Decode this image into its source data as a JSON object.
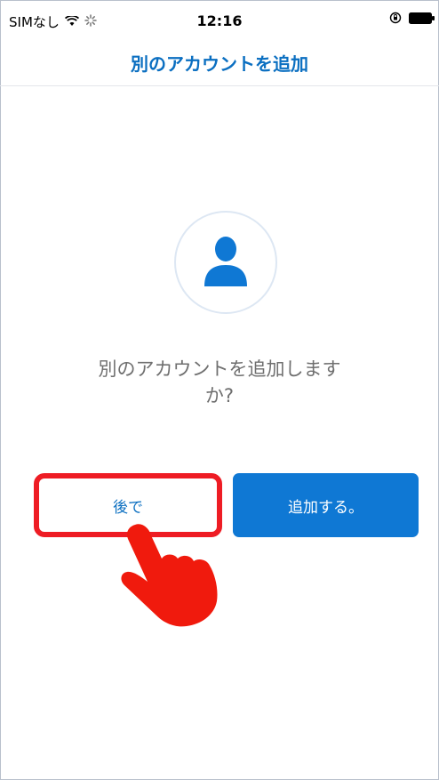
{
  "status_bar": {
    "carrier": "SIMなし",
    "time": "12:16"
  },
  "nav": {
    "title": "別のアカウントを追加"
  },
  "prompt": {
    "line1": "別のアカウントを追加します",
    "line2": "か?"
  },
  "buttons": {
    "later_label": "後で",
    "add_label": "追加する。"
  },
  "colors": {
    "accent": "#0f78d4",
    "title_blue": "#0b6fc1",
    "highlight_red": "#ee1c24"
  },
  "icons": [
    "wifi-icon",
    "activity-spinner-icon",
    "orientation-lock-icon",
    "battery-icon",
    "person-icon",
    "pointing-hand-icon"
  ]
}
